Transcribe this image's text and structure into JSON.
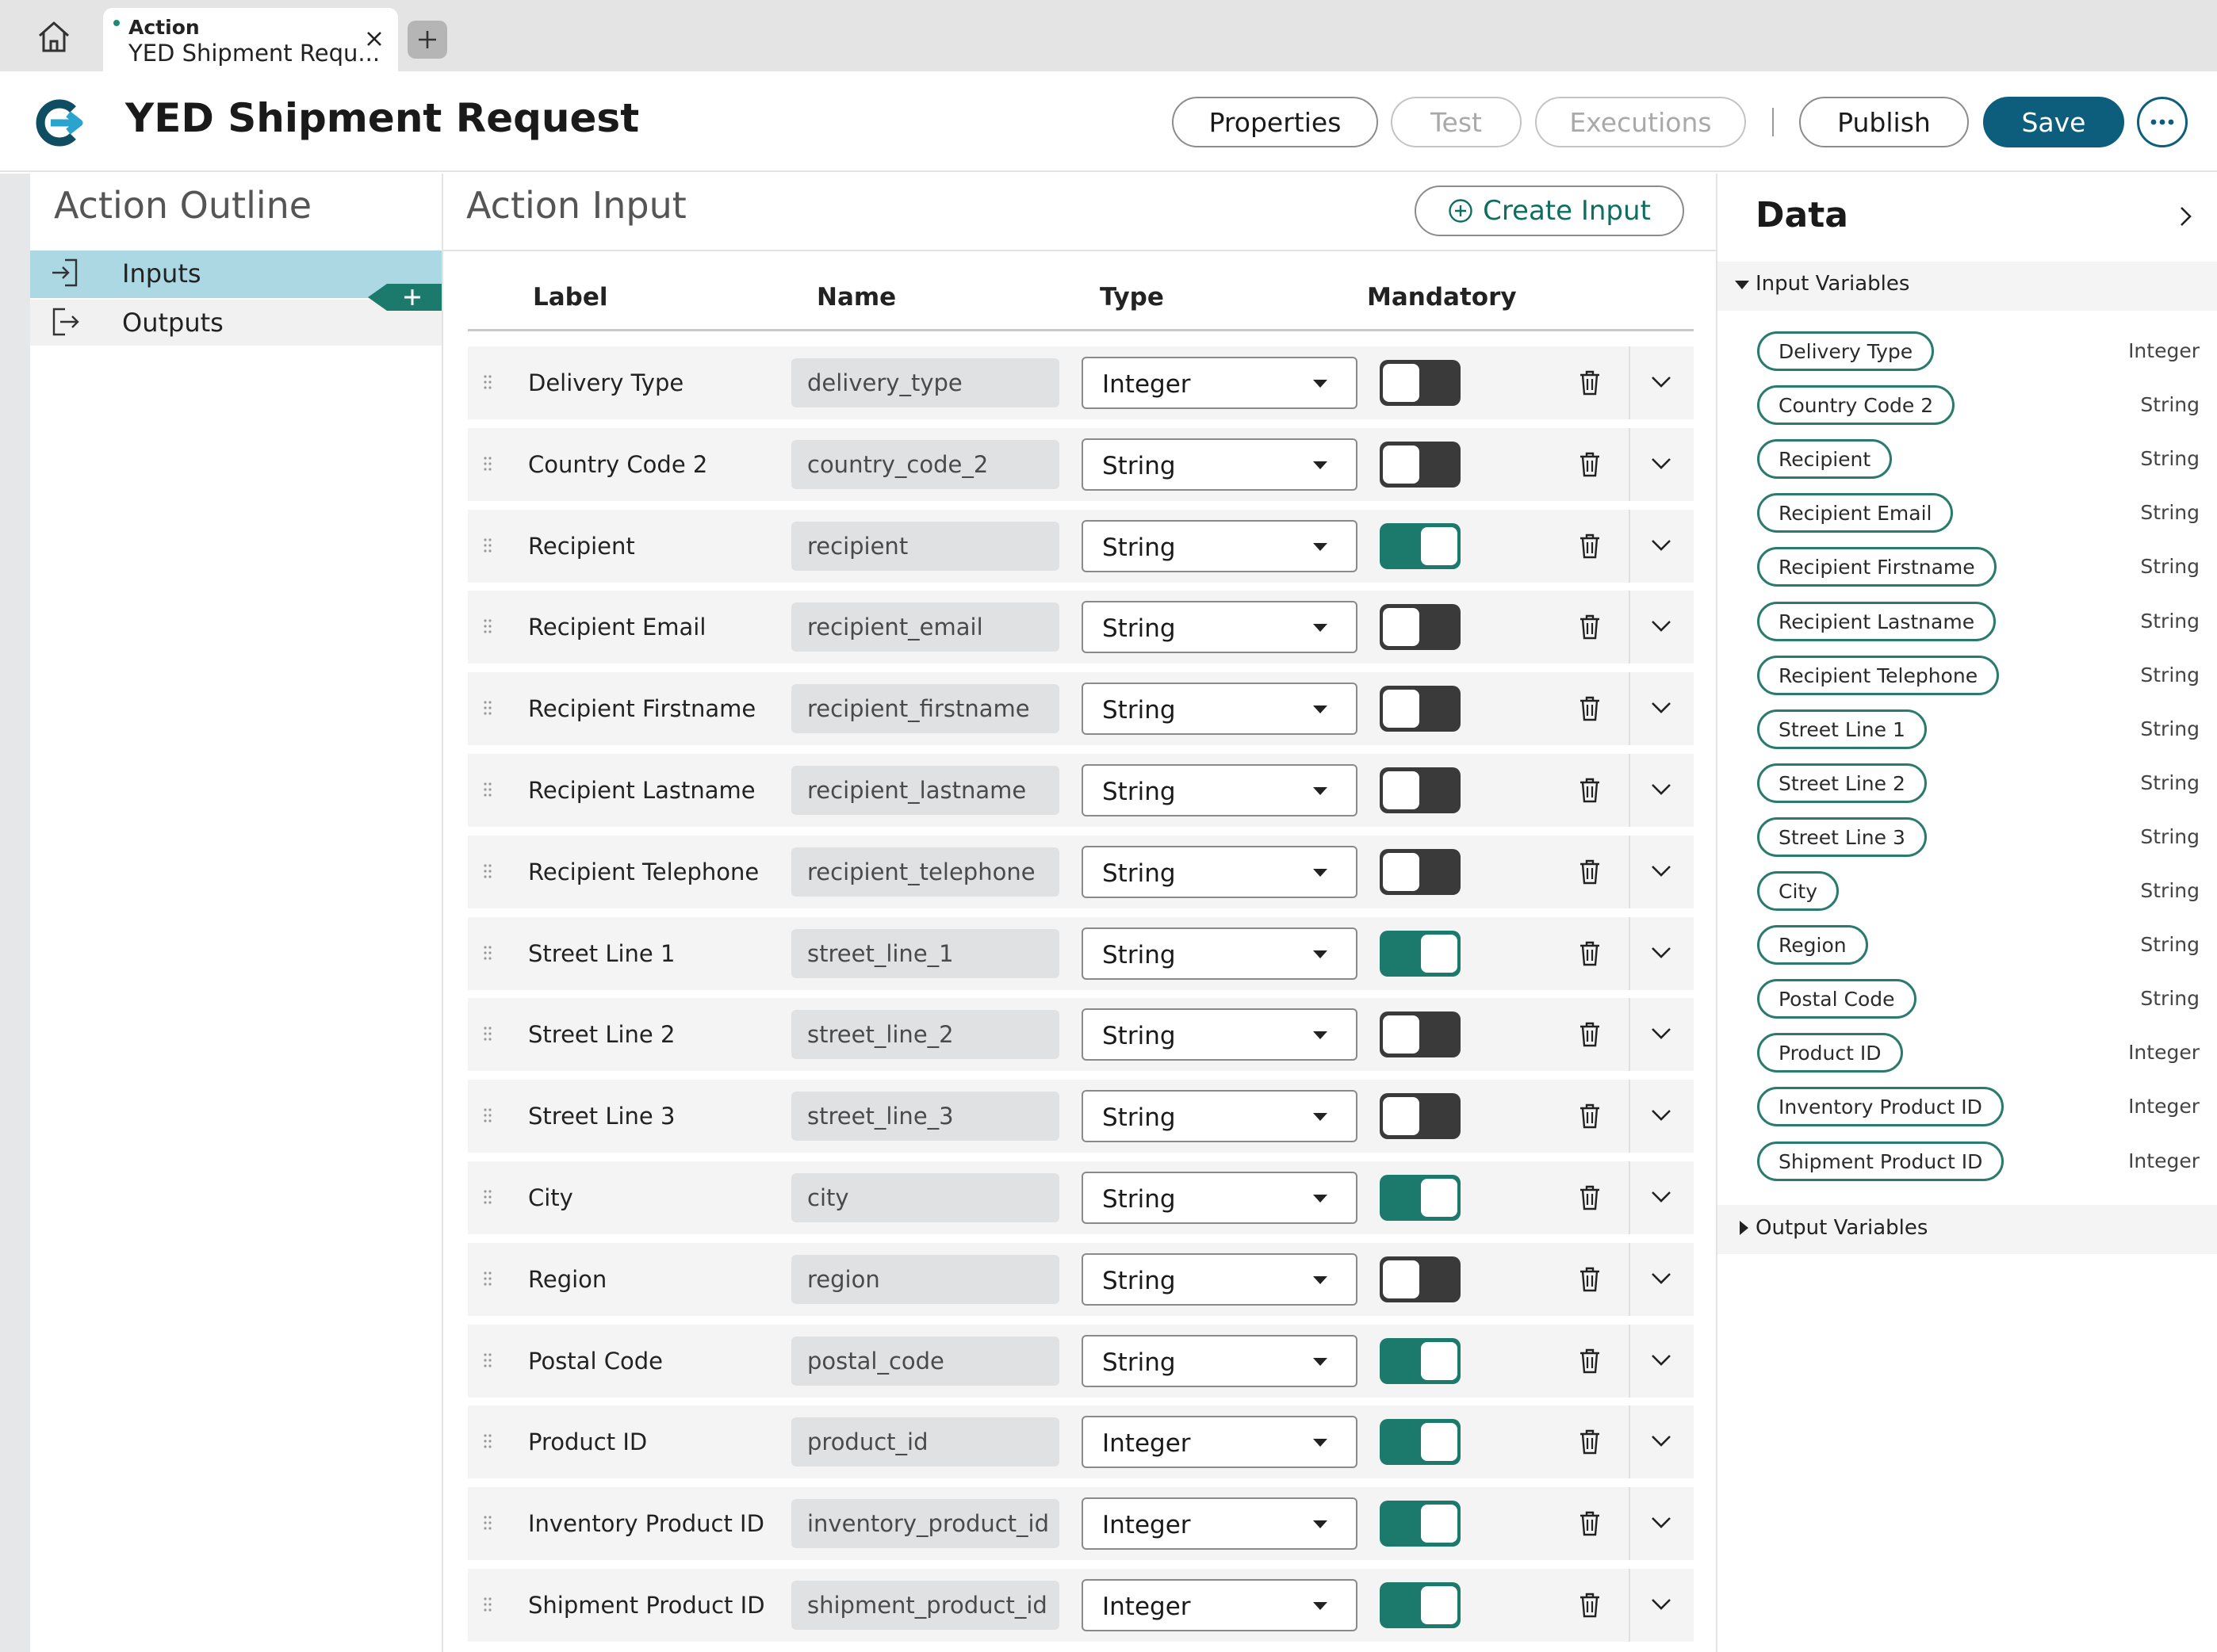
{
  "tabbar": {
    "tab": {
      "type": "Action",
      "title": "YED Shipment Requ..."
    }
  },
  "header": {
    "title": "YED Shipment Request",
    "buttons": {
      "properties": "Properties",
      "test": "Test",
      "executions": "Executions",
      "publish": "Publish",
      "save": "Save"
    }
  },
  "outline": {
    "title": "Action Outline",
    "items": [
      {
        "label": "Inputs",
        "selected": true
      },
      {
        "label": "Outputs",
        "selected": false
      }
    ]
  },
  "action_input": {
    "title": "Action Input",
    "create_button": "Create Input",
    "columns": {
      "label": "Label",
      "name": "Name",
      "type": "Type",
      "mandatory": "Mandatory"
    },
    "rows": [
      {
        "label": "Delivery Type",
        "name": "delivery_type",
        "type": "Integer",
        "mandatory": false
      },
      {
        "label": "Country Code 2",
        "name": "country_code_2",
        "type": "String",
        "mandatory": false
      },
      {
        "label": "Recipient",
        "name": "recipient",
        "type": "String",
        "mandatory": true
      },
      {
        "label": "Recipient Email",
        "name": "recipient_email",
        "type": "String",
        "mandatory": false
      },
      {
        "label": "Recipient Firstname",
        "name": "recipient_firstname",
        "type": "String",
        "mandatory": false
      },
      {
        "label": "Recipient Lastname",
        "name": "recipient_lastname",
        "type": "String",
        "mandatory": false
      },
      {
        "label": "Recipient Telephone",
        "name": "recipient_telephone",
        "type": "String",
        "mandatory": false
      },
      {
        "label": "Street Line 1",
        "name": "street_line_1",
        "type": "String",
        "mandatory": true
      },
      {
        "label": "Street Line 2",
        "name": "street_line_2",
        "type": "String",
        "mandatory": false
      },
      {
        "label": "Street Line 3",
        "name": "street_line_3",
        "type": "String",
        "mandatory": false
      },
      {
        "label": "City",
        "name": "city",
        "type": "String",
        "mandatory": true
      },
      {
        "label": "Region",
        "name": "region",
        "type": "String",
        "mandatory": false
      },
      {
        "label": "Postal Code",
        "name": "postal_code",
        "type": "String",
        "mandatory": true
      },
      {
        "label": "Product ID",
        "name": "product_id",
        "type": "Integer",
        "mandatory": true
      },
      {
        "label": "Inventory Product ID",
        "name": "inventory_product_id",
        "type": "Integer",
        "mandatory": true
      },
      {
        "label": "Shipment Product ID",
        "name": "shipment_product_id",
        "type": "Integer",
        "mandatory": true
      }
    ]
  },
  "data_panel": {
    "title": "Data",
    "input_variables_label": "Input Variables",
    "output_variables_label": "Output Variables",
    "input_variables": [
      {
        "label": "Delivery Type",
        "type": "Integer"
      },
      {
        "label": "Country Code 2",
        "type": "String"
      },
      {
        "label": "Recipient",
        "type": "String"
      },
      {
        "label": "Recipient Email",
        "type": "String"
      },
      {
        "label": "Recipient Firstname",
        "type": "String"
      },
      {
        "label": "Recipient Lastname",
        "type": "String"
      },
      {
        "label": "Recipient Telephone",
        "type": "String"
      },
      {
        "label": "Street Line 1",
        "type": "String"
      },
      {
        "label": "Street Line 2",
        "type": "String"
      },
      {
        "label": "Street Line 3",
        "type": "String"
      },
      {
        "label": "City",
        "type": "String"
      },
      {
        "label": "Region",
        "type": "String"
      },
      {
        "label": "Postal Code",
        "type": "String"
      },
      {
        "label": "Product ID",
        "type": "Integer"
      },
      {
        "label": "Inventory Product ID",
        "type": "Integer"
      },
      {
        "label": "Shipment Product ID",
        "type": "Integer"
      }
    ]
  },
  "colors": {
    "primary": "#0d5e7c",
    "toggle_on": "#1c7a6c",
    "toggle_off": "#3a3a3a",
    "selected_item": "#abd8e2",
    "chip_border": "#2a7a6d"
  }
}
